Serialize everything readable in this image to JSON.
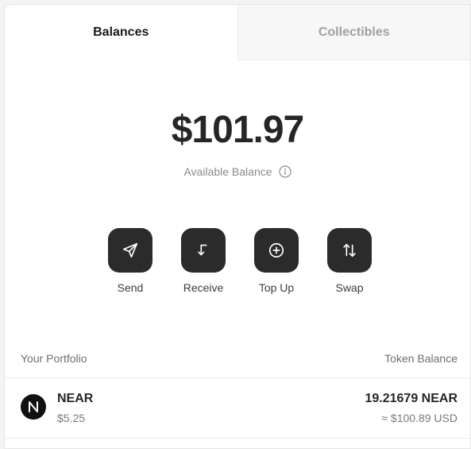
{
  "tabs": [
    {
      "label": "Balances",
      "active": true
    },
    {
      "label": "Collectibles",
      "active": false
    }
  ],
  "balance": {
    "amount": "$101.97",
    "label": "Available Balance",
    "info_icon": "info-circle-icon"
  },
  "actions": [
    {
      "label": "Send",
      "icon": "send-icon"
    },
    {
      "label": "Receive",
      "icon": "receive-arrow-icon"
    },
    {
      "label": "Top Up",
      "icon": "plus-circle-icon"
    },
    {
      "label": "Swap",
      "icon": "swap-arrows-icon"
    }
  ],
  "portfolio": {
    "left_header": "Your Portfolio",
    "right_header": "Token Balance",
    "tokens": [
      {
        "symbol": "NEAR",
        "price": "$5.25",
        "amount": "19.21679 NEAR",
        "usd_value": "≈ $100.89 USD",
        "icon": "near-logo-icon"
      }
    ]
  },
  "colors": {
    "button_bg": "#2b2b2b",
    "text_primary": "#262626",
    "text_muted": "#8a8a8a"
  }
}
